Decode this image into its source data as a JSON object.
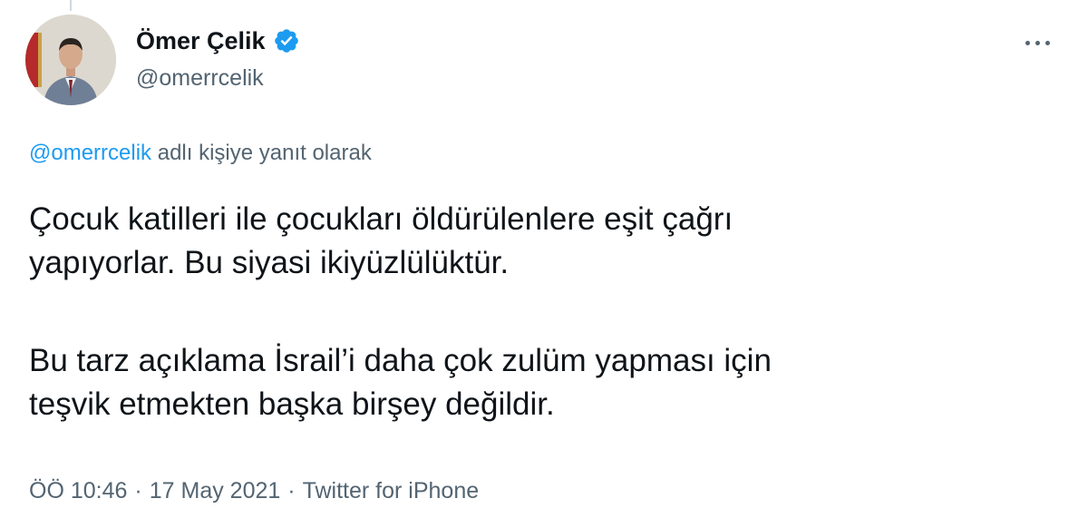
{
  "author": {
    "display_name": "Ömer Çelik",
    "handle": "@omerrcelik",
    "verified_icon": "verified-badge-icon",
    "avatar_icon": "profile-photo"
  },
  "more_icon": "more-options-icon",
  "reply_context": {
    "mention": "@omerrcelik",
    "suffix": "adlı kişiye yanıt olarak"
  },
  "tweet": {
    "paragraphs": [
      {
        "line1": "Çocuk katilleri ile çocukları öldürülenlere eşit çağrı",
        "line2": "yapıyorlar. Bu siyasi ikiyüzlülüktür."
      },
      {
        "line1": "Bu tarz açıklama İsrail’i daha çok zulüm yapması için",
        "line2": "teşvik etmekten başka birşey değildir."
      }
    ]
  },
  "meta": {
    "time": "ÖÖ 10:46",
    "separator": "·",
    "date": "17 May 2021",
    "source": "Twitter for iPhone"
  },
  "colors": {
    "accent": "#1d9bf0",
    "secondary_text": "#536471",
    "primary_text": "#0f1419"
  }
}
